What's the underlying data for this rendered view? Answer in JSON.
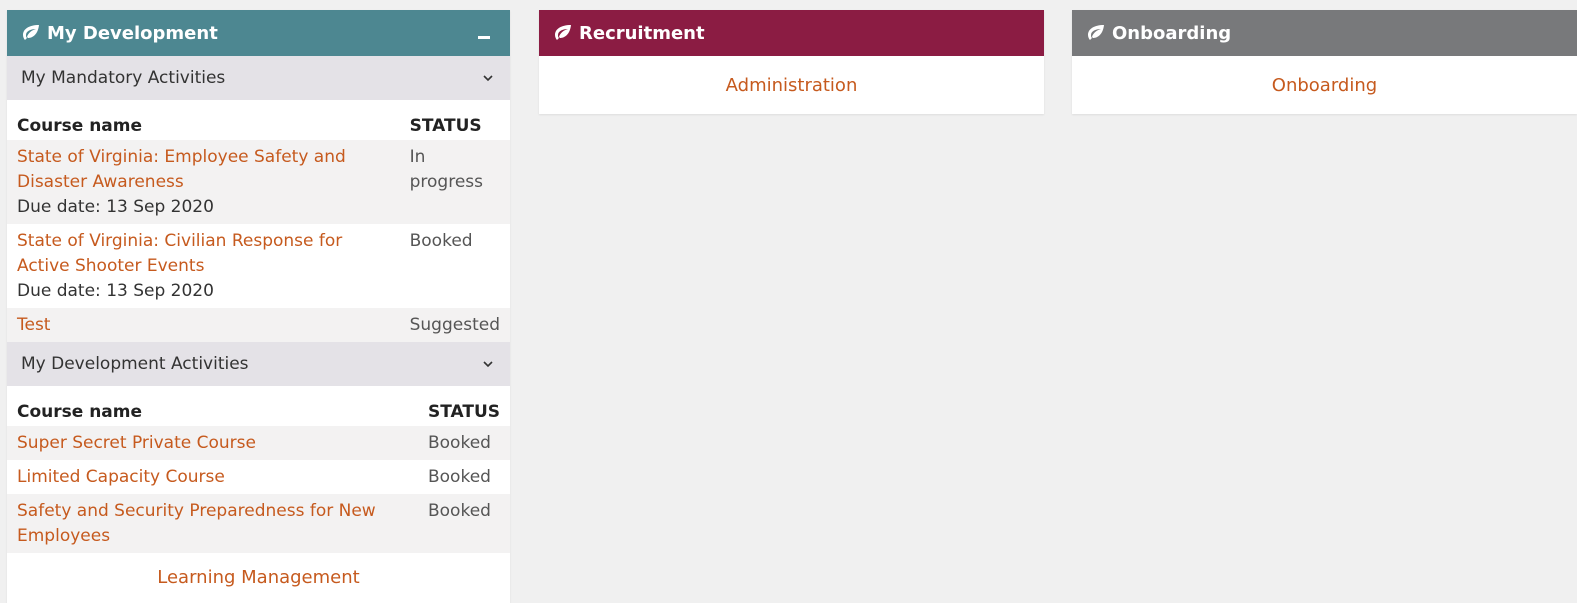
{
  "panels": {
    "development": {
      "title": "My Development",
      "color": "#4d8791",
      "mandatory": {
        "title": "My Mandatory Activities",
        "col_course": "Course name",
        "col_status": "STATUS",
        "rows": [
          {
            "course": "State of Virginia: Employee Safety and Disaster Awareness",
            "due": "Due date: 13 Sep 2020",
            "status": "In progress"
          },
          {
            "course": "State of Virginia: Civilian Response for Active Shooter Events",
            "due": "Due date: 13 Sep 2020",
            "status": "Booked"
          },
          {
            "course": "Test",
            "due": "",
            "status": "Suggested"
          }
        ]
      },
      "activities": {
        "title": "My Development Activities",
        "col_course": "Course name",
        "col_status": "STATUS",
        "rows": [
          {
            "course": "Super Secret Private Course",
            "status": "Booked"
          },
          {
            "course": "Limited Capacity Course",
            "status": "Booked"
          },
          {
            "course": "Safety and Security Preparedness for New Employees",
            "status": "Booked"
          }
        ]
      },
      "footer_link": "Learning Management"
    },
    "recruitment": {
      "title": "Recruitment",
      "color": "#8b1c43",
      "link": "Administration"
    },
    "onboarding": {
      "title": "Onboarding",
      "color": "#78797b",
      "link": "Onboarding"
    }
  }
}
